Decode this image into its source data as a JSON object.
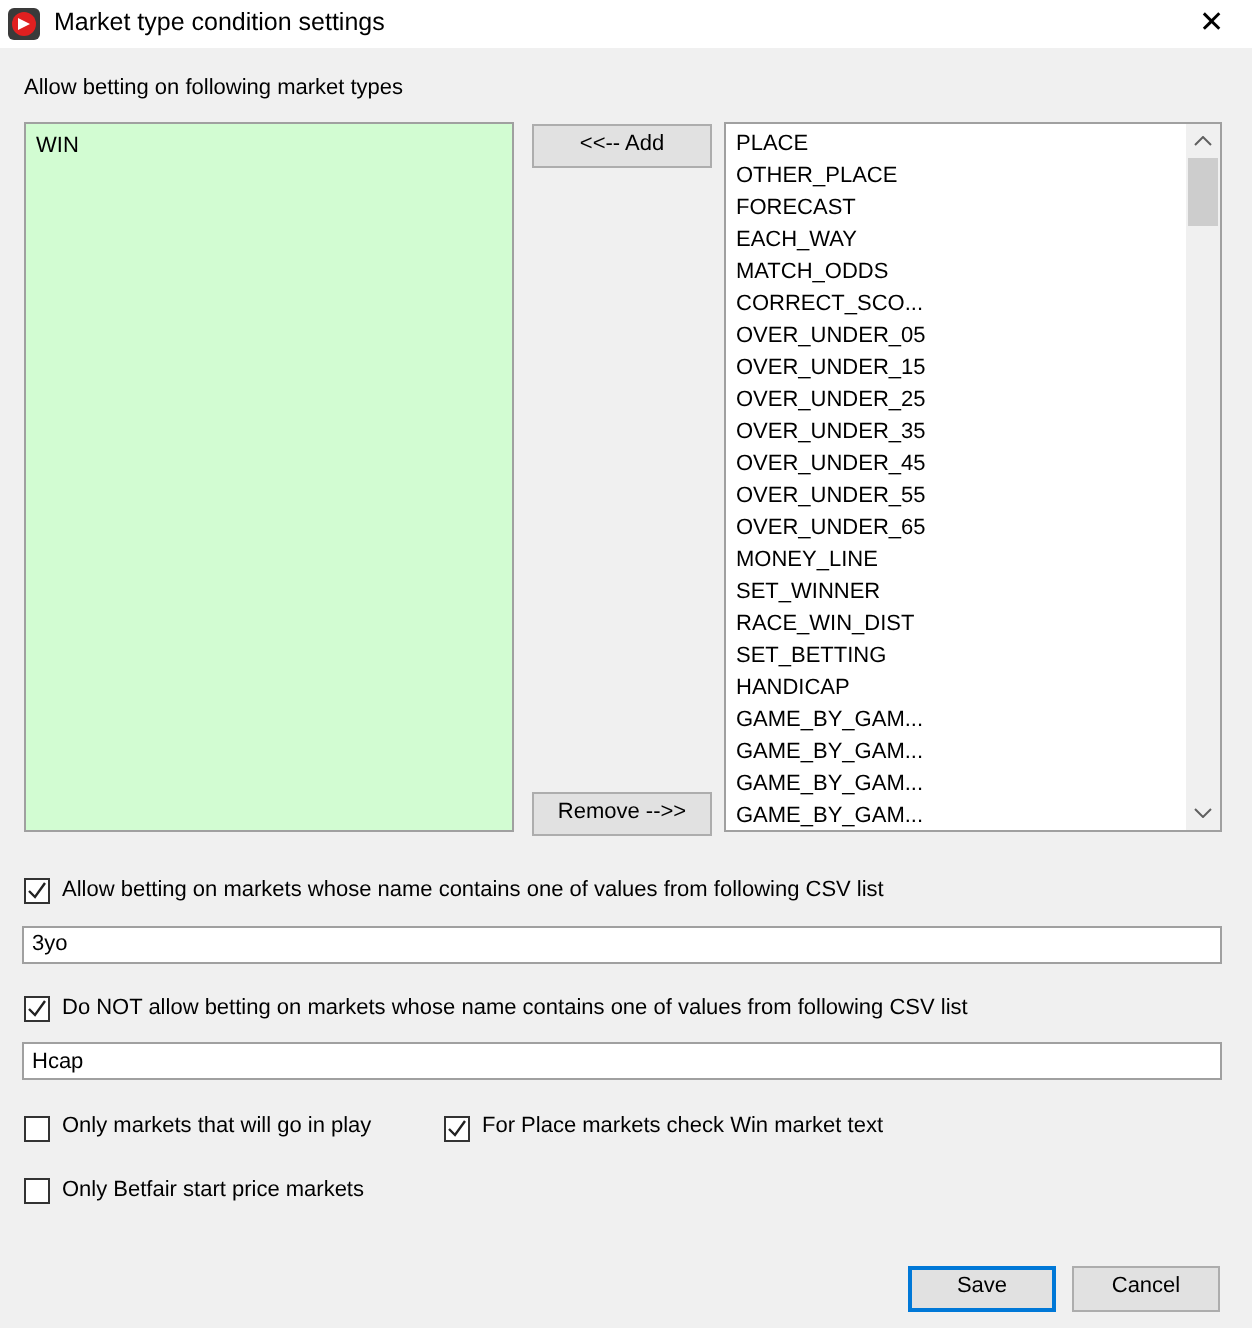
{
  "window": {
    "title": "Market type condition settings",
    "close": "✕"
  },
  "section_label": "Allow betting on following market types",
  "allowed_list": [
    "WIN"
  ],
  "add_button": "<<-- Add",
  "remove_button": "Remove -->>",
  "available_list": [
    "PLACE",
    "OTHER_PLACE",
    "FORECAST",
    "EACH_WAY",
    "MATCH_ODDS",
    "CORRECT_SCO...",
    "OVER_UNDER_05",
    "OVER_UNDER_15",
    "OVER_UNDER_25",
    "OVER_UNDER_35",
    "OVER_UNDER_45",
    "OVER_UNDER_55",
    "OVER_UNDER_65",
    "MONEY_LINE",
    "SET_WINNER",
    "RACE_WIN_DIST",
    "SET_BETTING",
    "HANDICAP",
    "GAME_BY_GAM...",
    "GAME_BY_GAM...",
    "GAME_BY_GAM...",
    "GAME_BY_GAM..."
  ],
  "include_filter": {
    "label": "Allow betting on markets whose name contains one of values from following CSV list",
    "checked": true,
    "value": "3yo"
  },
  "exclude_filter": {
    "label": "Do NOT allow betting on markets whose name contains one of values from following CSV list",
    "checked": true,
    "value": "Hcap"
  },
  "options": [
    {
      "label": "Only markets that will go in play",
      "checked": false
    },
    {
      "label": "For Place markets check Win market text",
      "checked": true
    },
    {
      "label": "Only Betfair start price markets",
      "checked": false
    }
  ],
  "buttons": [
    {
      "label": "Save",
      "selected": true
    },
    {
      "label": "Cancel",
      "selected": false
    }
  ]
}
